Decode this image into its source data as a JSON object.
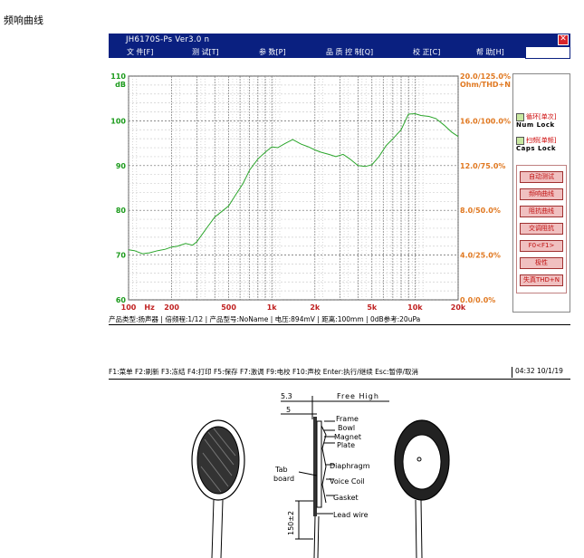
{
  "page_caption": "频响曲线",
  "app": {
    "title": "JH6170S-Ps   Ver3.0  n",
    "close_glyph": "✕"
  },
  "menu": [
    {
      "label": "文  件[F]"
    },
    {
      "label": "测  试[T]"
    },
    {
      "label": "参  数[P]"
    },
    {
      "label": "品  质  控  制[Q]"
    },
    {
      "label": "校  正[C]"
    },
    {
      "label": "帮  助[H]"
    }
  ],
  "chart_data": {
    "type": "line",
    "x_scale": "log",
    "xlim": [
      100,
      20000
    ],
    "ylim": [
      60,
      110
    ],
    "left_axis_unit": "dB",
    "right_axis_unit": "Ohm/THD+N",
    "left_ticks": [
      "110",
      "100",
      "90",
      "80",
      "70",
      "60"
    ],
    "right_ticks": [
      "20.0/125.0%",
      "16.0/100.0%",
      "12.0/75.0%",
      "8.0/50.0%",
      "4.0/25.0%",
      "0.0/0.0%"
    ],
    "x_ticks": [
      "100",
      "Hz",
      "200",
      "500",
      "1k",
      "2k",
      "5k",
      "10k",
      "20k"
    ],
    "grid": true,
    "series": [
      {
        "color": "#2aa52a",
        "x": [
          100,
          110,
          125,
          140,
          160,
          180,
          200,
          220,
          250,
          280,
          300,
          350,
          400,
          450,
          500,
          560,
          630,
          700,
          800,
          900,
          1000,
          1100,
          1250,
          1400,
          1600,
          1800,
          2000,
          2200,
          2500,
          2800,
          3150,
          3500,
          4000,
          4500,
          5000,
          5600,
          6300,
          7000,
          8000,
          9000,
          10000,
          11000,
          12500,
          14000,
          16000,
          18000,
          20000
        ],
        "y": [
          71.2,
          71.0,
          70.3,
          70.5,
          71.0,
          71.3,
          71.8,
          72.0,
          72.6,
          72.2,
          73.0,
          76.0,
          78.5,
          79.8,
          81.0,
          83.5,
          86.0,
          89.0,
          91.5,
          93.0,
          94.2,
          94.0,
          95.0,
          95.8,
          94.8,
          94.2,
          93.5,
          93.0,
          92.5,
          92.0,
          92.5,
          91.5,
          90.0,
          89.8,
          90.2,
          92.0,
          94.5,
          96.0,
          98.0,
          101.5,
          101.6,
          101.2,
          101.0,
          100.5,
          99.0,
          97.5,
          96.5
        ]
      }
    ]
  },
  "side_panel": {
    "indicator1": {
      "tag": "循环[单次]",
      "label": "Num Lock"
    },
    "indicator2": {
      "tag": "扫频[单频]",
      "label": "Caps Lock"
    },
    "buttons": [
      "自动测试",
      "频响曲线",
      "阻抗曲线",
      "交调阻抗",
      "F0<F1>",
      "极性",
      "失真THD+N"
    ]
  },
  "status_line": "产品类型:扬声器 | 倍频程:1/12 | 产品型号:NoName | 电压:894mV | 距离:100mm | 0dB参考:20uPa",
  "fkey_bar": "F1:菜单 F2:刷新 F3:冻结 F4:打印 F5:保存 F7:激调 F9:电校 F10:声校 Enter:执行/继续  Esc:暂停/取消",
  "clock": "04:32  10/1/19",
  "drawing": {
    "dim_top": "5.3",
    "dim_sub": "5",
    "free_high": "Free High",
    "dim_side": "150±2",
    "labels": [
      "Frame",
      "Bowl",
      "Magnet",
      "Plate",
      "Diaphragm",
      "Voice Coil",
      "Gasket",
      "Lead wire",
      "Tab",
      "board"
    ]
  }
}
